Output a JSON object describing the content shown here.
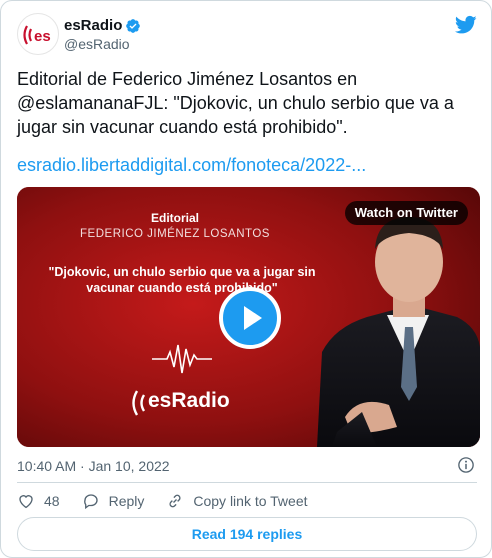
{
  "account": {
    "display_name": "esRadio",
    "handle": "@esRadio",
    "avatar_text": "(es"
  },
  "tweet": {
    "text": "Editorial de Federico Jiménez Losantos en @eslamananaFJL: \"Djokovic, un chulo serbio que va a jugar sin vacunar cuando está prohibido\".",
    "link": "esradio.libertaddigital.com/fonoteca/2022-..."
  },
  "media": {
    "watch_label": "Watch on Twitter",
    "heading": "Editorial",
    "author": "FEDERICO JIMÉNEZ LOSANTOS",
    "quote": "\"Djokovic, un chulo serbio que va a jugar sin vacunar cuando está prohibido\"",
    "logo_text": "esRadio"
  },
  "meta": {
    "timestamp": "10:40 AM · Jan 10, 2022"
  },
  "actions": {
    "likes": "48",
    "reply_label": "Reply",
    "copy_label": "Copy link to Tweet"
  },
  "footer": {
    "read_replies": "Read 194 replies"
  },
  "colors": {
    "accent": "#1d9bf0",
    "like": "#f91880",
    "brand_red": "#c8102e"
  }
}
